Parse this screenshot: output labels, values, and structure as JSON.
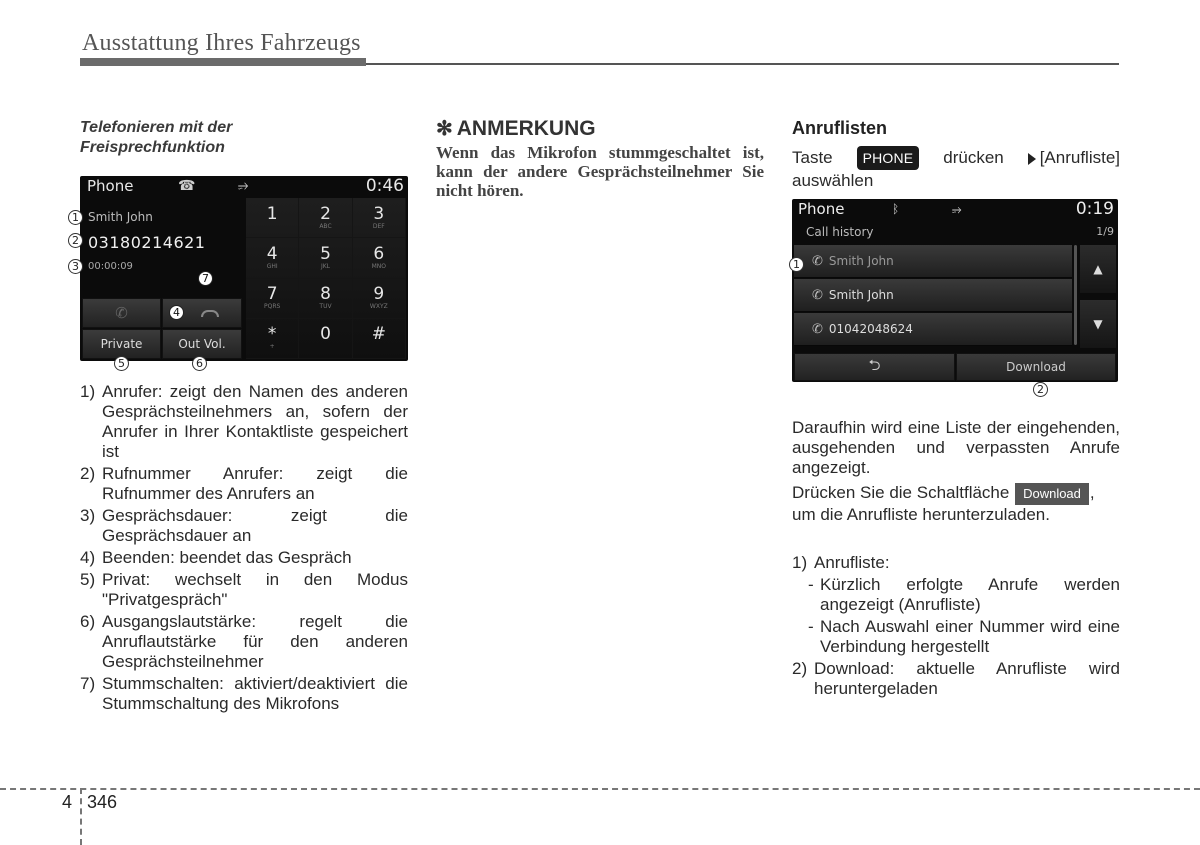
{
  "header": {
    "title": "Ausstattung Ihres Fahrzeugs"
  },
  "left": {
    "subtitle_line1": "Telefonieren mit der",
    "subtitle_line2": "Freisprechfunktion",
    "screen": {
      "app": "Phone",
      "time": "0:46",
      "status_icons": [
        "phone-icon",
        "usb-icon"
      ],
      "caller_name": "Smith John",
      "caller_number": "03180214621",
      "duration": "00:00:09",
      "buttons": {
        "private": "Private",
        "out_vol": "Out Vol."
      },
      "keypad": [
        {
          "digit": "1",
          "letters": ""
        },
        {
          "digit": "2",
          "letters": "ABC"
        },
        {
          "digit": "3",
          "letters": "DEF"
        },
        {
          "digit": "4",
          "letters": "GHI"
        },
        {
          "digit": "5",
          "letters": "JKL"
        },
        {
          "digit": "6",
          "letters": "MNO"
        },
        {
          "digit": "7",
          "letters": "PQRS"
        },
        {
          "digit": "8",
          "letters": "TUV"
        },
        {
          "digit": "9",
          "letters": "WXYZ"
        },
        {
          "digit": "*",
          "letters": "+"
        },
        {
          "digit": "0",
          "letters": ""
        },
        {
          "digit": "#",
          "letters": ""
        }
      ],
      "callouts": [
        "1",
        "2",
        "3",
        "4",
        "5",
        "6",
        "7"
      ]
    },
    "items": [
      {
        "num": "1)",
        "text": "Anrufer: zeigt den Namen des anderen Gesprächsteilnehmers an, sofern der Anrufer in Ihrer Kontaktliste gespeichert ist"
      },
      {
        "num": "2)",
        "text": "Rufnummer Anrufer: zeigt die Rufnummer des Anrufers an"
      },
      {
        "num": "3)",
        "text": "Gesprächsdauer: zeigt die Gesprächsdauer an"
      },
      {
        "num": "4)",
        "text": "Beenden: beendet das Gespräch"
      },
      {
        "num": "5)",
        "text": "Privat: wechselt in den Modus \"Privatgespräch\""
      },
      {
        "num": "6)",
        "text": "Ausgangslautstärke: regelt die Anruflautstärke für den anderen Gesprächsteilnehmer"
      },
      {
        "num": "7)",
        "text": "Stummschalten: aktiviert/deaktiviert die Stummschaltung des Mikrofons"
      }
    ]
  },
  "middle": {
    "note_symbol": "✻",
    "note_title": "ANMERKUNG",
    "note_text": "Wenn das Mikrofon stummgeschaltet ist, kann der andere Gesprächsteilnehmer Sie nicht hören."
  },
  "right": {
    "title": "Anruflisten",
    "instr_taste": "Taste",
    "instr_key": "PHONE",
    "instr_druecken": "drücken",
    "instr_select": "[Anrufliste]",
    "instr_line2": "auswählen",
    "screen": {
      "app": "Phone",
      "time": "0:19",
      "status_icons": [
        "bluetooth-icon",
        "usb-icon"
      ],
      "subtitle": "Call history",
      "page": "1/9",
      "rows": [
        {
          "type": "outgoing",
          "label": "Smith John"
        },
        {
          "type": "incoming",
          "label": "Smith John"
        },
        {
          "type": "outgoing",
          "label": "01042048624"
        }
      ],
      "back_label": "⮌",
      "download_label": "Download",
      "callouts": [
        "1",
        "2"
      ]
    },
    "para1": "Daraufhin wird eine Liste der eingehenden, ausgehenden und verpassten Anrufe angezeigt.",
    "para2_pre": "Drücken Sie die Schaltfläche",
    "para2_badge": "Download",
    "para2_post": ",",
    "para2_line2": "um die Anrufliste herunterzuladen.",
    "list": {
      "item1_num": "1)",
      "item1_title": "Anrufliste:",
      "sub1": "Kürzlich erfolgte Anrufe werden angezeigt (Anrufliste)",
      "sub2": "Nach Auswahl einer Nummer wird eine Verbindung hergestellt",
      "item2_num": "2)",
      "item2_text": "Download: aktuelle Anrufliste wird heruntergeladen"
    }
  },
  "footer": {
    "chapter": "4",
    "page": "346"
  }
}
